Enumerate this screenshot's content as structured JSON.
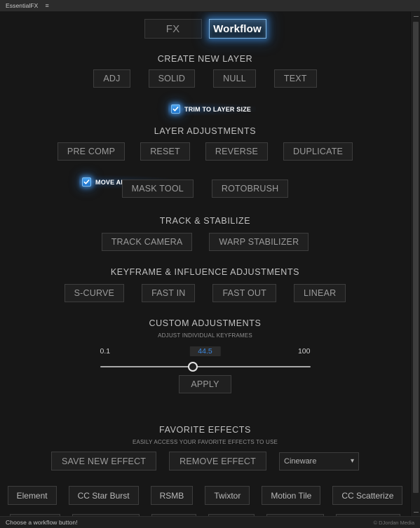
{
  "window": {
    "panel_title": "EssentialFX",
    "menu_icon": "hamburger-menu-icon"
  },
  "tabs": [
    {
      "label": "FX",
      "active": false
    },
    {
      "label": "Workflow",
      "active": true
    }
  ],
  "sections": {
    "create_new_layer": {
      "title": "CREATE NEW LAYER",
      "buttons": [
        "ADJ",
        "SOLID",
        "NULL",
        "TEXT"
      ],
      "checkbox": {
        "label": "TRIM TO LAYER SIZE",
        "checked": true
      }
    },
    "layer_adjustments": {
      "title": "LAYER ADJUSTMENTS",
      "buttons_row1": [
        "PRE COMP",
        "RESET",
        "REVERSE",
        "DUPLICATE"
      ],
      "checkbox": {
        "label": "MOVE ALL ATTRIBUTES",
        "checked": true
      },
      "buttons_row2": [
        "MASK TOOL",
        "ROTOBRUSH"
      ]
    },
    "track_stabilize": {
      "title": "TRACK & STABILIZE",
      "buttons": [
        "TRACK CAMERA",
        "WARP STABILIZER"
      ]
    },
    "keyframe_influence": {
      "title": "KEYFRAME & INFLUENCE ADJUSTMENTS",
      "buttons": [
        "S-CURVE",
        "FAST IN",
        "FAST OUT",
        "LINEAR"
      ]
    },
    "custom_adjustments": {
      "title": "CUSTOM ADJUSTMENTS",
      "subtitle": "ADJUST INDIVIDUAL KEYFRAMES",
      "slider": {
        "min": "0.1",
        "max": "100",
        "value": "44.5",
        "percent": 44
      },
      "apply_label": "APPLY"
    },
    "favorite_effects": {
      "title": "FAVORITE EFFECTS",
      "subtitle": "EASILY ACCESS YOUR FAVORITE EFFECTS TO USE",
      "save_label": "SAVE NEW EFFECT",
      "remove_label": "REMOVE EFFECT",
      "dropdown": {
        "selected": "Cineware",
        "icon": "chevron-down-icon"
      },
      "effect_buttons": [
        "Element",
        "CC Star Burst",
        "RSMB",
        "Twixtor",
        "Motion Tile",
        "CC Scatterize"
      ]
    }
  },
  "statusbar": {
    "message": "Choose a workflow button!",
    "copyright": "© DJordan Media"
  },
  "colors": {
    "accent_blue": "#3b88e0",
    "glow_blue": "#4aa3f0",
    "background": "#171717",
    "button_border": "#3d3d3d"
  }
}
